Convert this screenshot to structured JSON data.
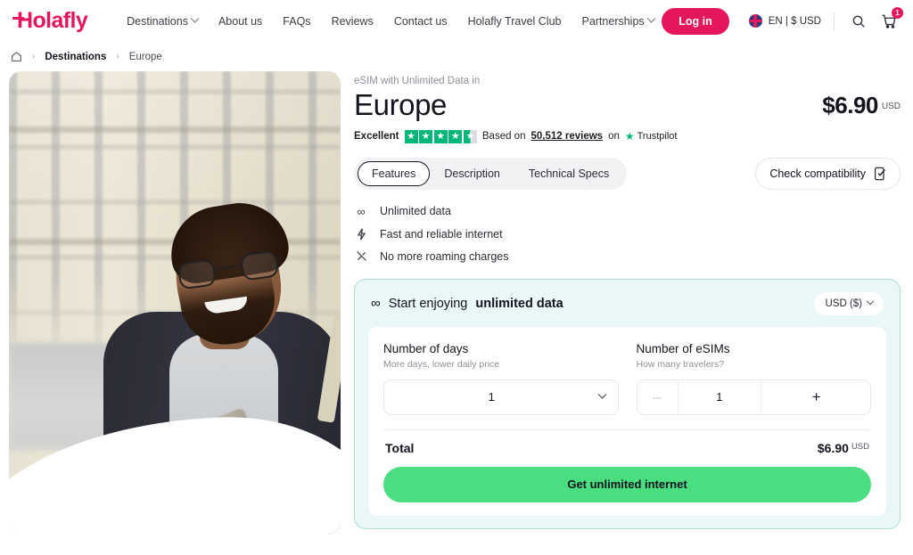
{
  "header": {
    "logo": "Holafly",
    "nav": [
      {
        "label": "Destinations",
        "has_caret": true
      },
      {
        "label": "About us",
        "has_caret": false
      },
      {
        "label": "FAQs",
        "has_caret": false
      },
      {
        "label": "Reviews",
        "has_caret": false
      },
      {
        "label": "Contact us",
        "has_caret": false
      },
      {
        "label": "Holafly Travel Club",
        "has_caret": false
      },
      {
        "label": "Partnerships",
        "has_caret": true
      }
    ],
    "login_label": "Log in",
    "language": "EN | $ USD",
    "flag_icon": "uk-flag-icon",
    "search_icon": "search-icon",
    "cart_icon": "cart-icon",
    "cart_count": "1",
    "accent_color": "#e3175a"
  },
  "breadcrumb": {
    "home_icon": "home-icon",
    "separator": "›",
    "items": [
      {
        "label": "Destinations",
        "bold": true
      },
      {
        "label": "Europe",
        "bold": false
      }
    ]
  },
  "product": {
    "eyebrow": "eSIM with Unlimited Data in",
    "title": "Europe",
    "price": "$6.90",
    "currency": "USD"
  },
  "rating": {
    "verdict": "Excellent",
    "stars_full": 4,
    "has_half": true,
    "star_color": "#00b67a",
    "based_on": "Based on",
    "reviews": "50,512 reviews",
    "on": "on",
    "platform": "Trustpilot"
  },
  "tabs": [
    {
      "label": "Features",
      "active": true
    },
    {
      "label": "Description",
      "active": false
    },
    {
      "label": "Technical Specs",
      "active": false
    }
  ],
  "compatibility": {
    "label": "Check compatibility",
    "icon": "phone-check-icon"
  },
  "features": [
    {
      "icon": "infinity-icon",
      "glyph": "∞",
      "label": "Unlimited data"
    },
    {
      "icon": "lightning-icon",
      "glyph": "⚡",
      "label": "Fast and reliable internet"
    },
    {
      "icon": "no-roaming-icon",
      "glyph": "✕",
      "label": "No more roaming charges"
    }
  ],
  "purchase_card": {
    "heading_prefix": "Start enjoying",
    "heading_bold": "unlimited data",
    "heading_icon": "infinity-icon",
    "currency_selector": "USD ($)",
    "days": {
      "label": "Number of days",
      "sublabel": "More days, lower daily price",
      "value": "1"
    },
    "esims": {
      "label": "Number of eSIMs",
      "sublabel": "How many travelers?",
      "value": "1",
      "minus": "–",
      "plus": "+"
    },
    "total_label": "Total",
    "total_value": "$6.90",
    "total_currency": "USD",
    "cta_label": "Get unlimited internet",
    "cta_color": "#4ade80",
    "card_bg": "#eaf7f7",
    "card_border": "#a9dfd3"
  },
  "hero": {
    "alt": "Smiling man with glasses using a smartphone in front of a Parisian building"
  }
}
